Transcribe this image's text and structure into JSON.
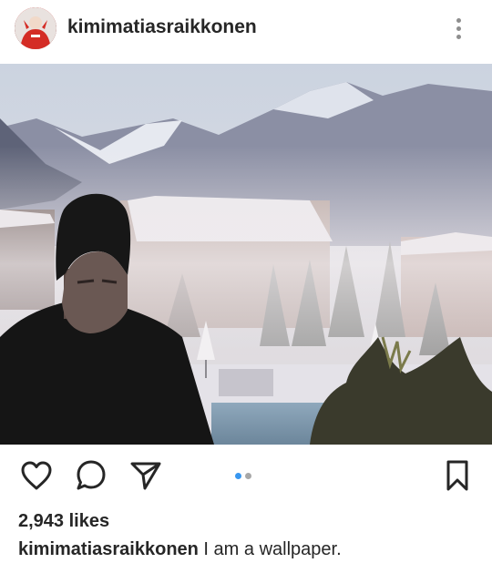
{
  "post": {
    "username": "kimimatiasraikkonen",
    "likes": "2,943 likes",
    "caption_user": "kimimatiasraikkonen",
    "caption_text": " I am a wallpaper."
  },
  "icons": {
    "more": "more-vertical-icon",
    "like": "heart-icon",
    "comment": "comment-icon",
    "share": "send-icon",
    "save": "bookmark-icon"
  },
  "carousel": {
    "count": 2,
    "active_index": 0
  },
  "colors": {
    "text": "#262626",
    "muted": "#8e8e8e",
    "accent": "#3897f0"
  }
}
